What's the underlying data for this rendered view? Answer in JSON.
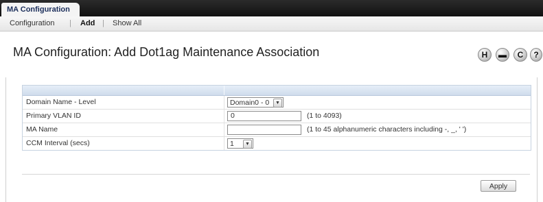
{
  "top_tab": "MA Configuration",
  "subnav": {
    "items": [
      "Configuration",
      "Add",
      "Show All"
    ],
    "selected": "Add",
    "separator": "|"
  },
  "title": "MA Configuration: Add Dot1ag Maintenance Association",
  "toolbar": {
    "icons": [
      "help-desk-icon",
      "print-icon",
      "refresh-icon",
      "help-icon"
    ],
    "glyphs": [
      "H",
      "▬",
      "C",
      "?"
    ]
  },
  "form": {
    "rows": [
      {
        "label": "Domain Name - Level",
        "control": "select",
        "value": "Domain0 - 0",
        "hint": ""
      },
      {
        "label": "Primary VLAN ID",
        "control": "input",
        "value": "0",
        "hint": "(1 to 4093)"
      },
      {
        "label": "MA Name",
        "control": "input",
        "value": "",
        "hint": "(1 to 45 alphanumeric characters including -, _, ' ')"
      },
      {
        "label": "CCM Interval (secs)",
        "control": "select",
        "value": "1",
        "hint": ""
      }
    ]
  },
  "apply_label": "Apply",
  "colors": {
    "topbar": "#111111",
    "title_text": "#222222",
    "table_header": "#d6e2f0"
  }
}
